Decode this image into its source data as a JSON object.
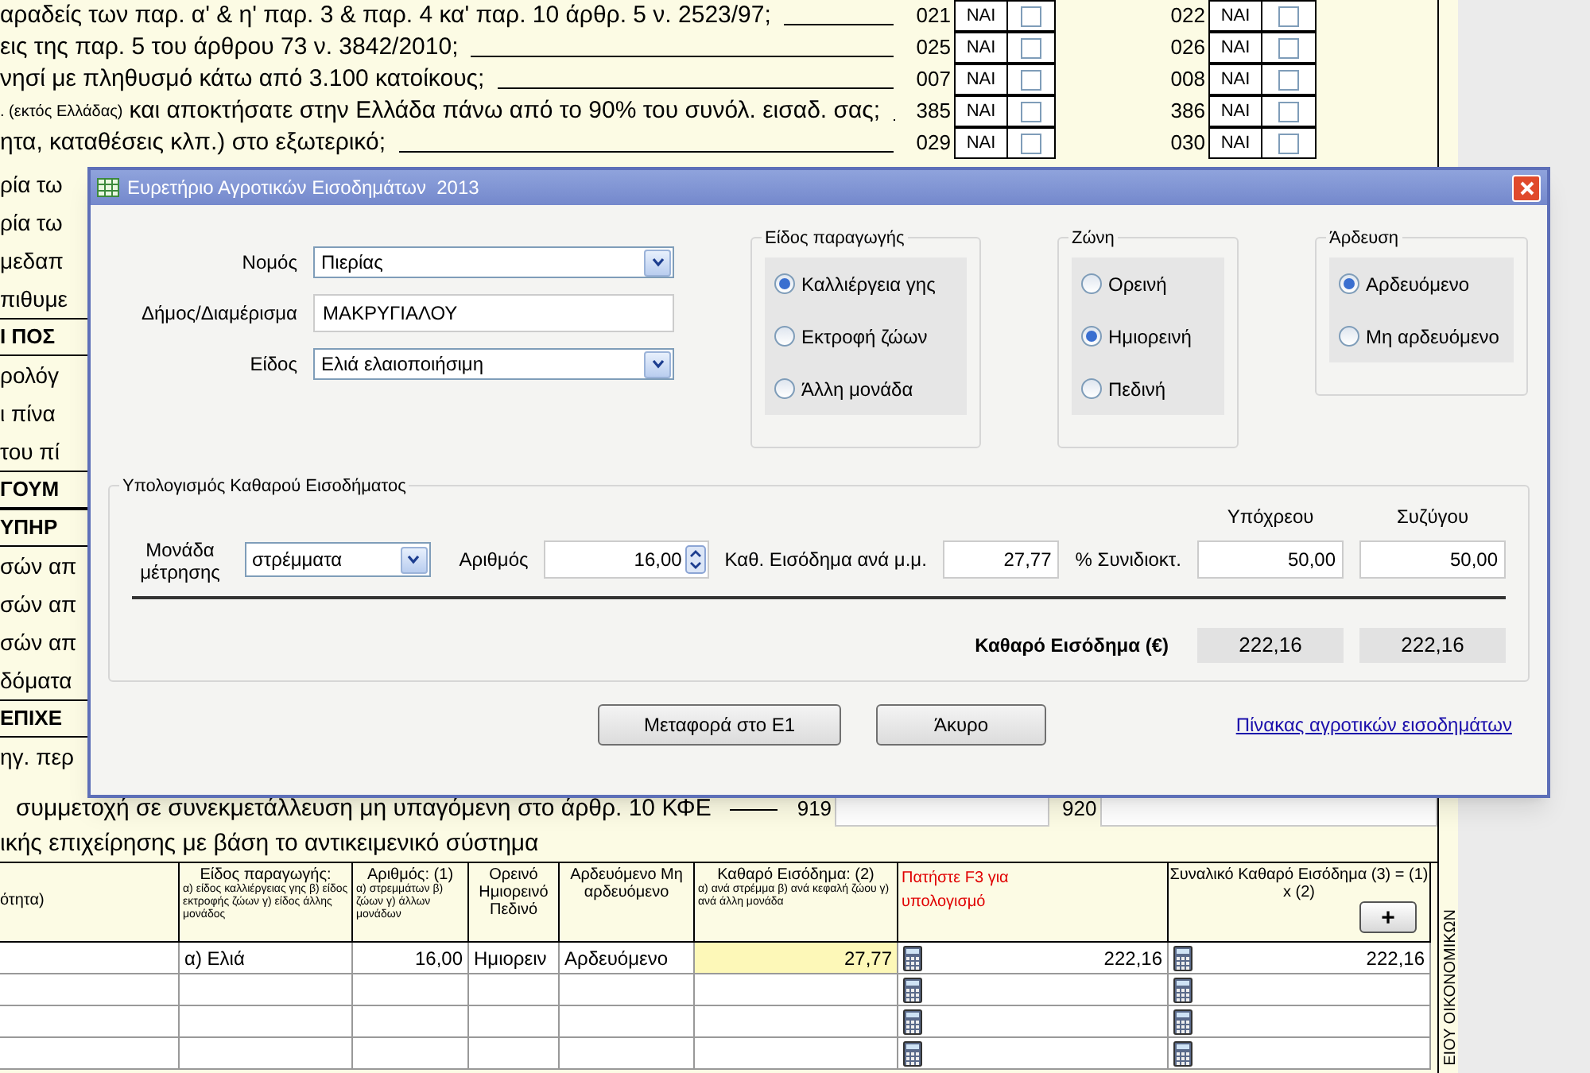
{
  "background_form": {
    "question_rows": [
      {
        "prefix": "",
        "text": "αραδείς των παρ. α' & η' παρ. 3 & παρ. 4 κα' παρ. 10 άρθρ. 5 ν. 2523/97;",
        "code_1": "021",
        "answer_1": "ΝΑΙ",
        "checked_1": false,
        "code_2": "022",
        "answer_2": "ΝΑΙ",
        "checked_2": false
      },
      {
        "prefix": "",
        "text": "εις της παρ. 5 του άρθρου 73 ν. 3842/2010;",
        "code_1": "025",
        "answer_1": "ΝΑΙ",
        "checked_1": false,
        "code_2": "026",
        "answer_2": "ΝΑΙ",
        "checked_2": false
      },
      {
        "prefix": "",
        "text": "νησί με πληθυσμό κάτω από 3.100 κατοίκους;",
        "code_1": "007",
        "answer_1": "ΝΑΙ",
        "checked_1": false,
        "code_2": "008",
        "answer_2": "ΝΑΙ",
        "checked_2": false
      },
      {
        "prefix": ". (εκτός Ελλάδας)",
        "text": "και αποκτήσατε στην Ελλάδα πάνω από το 90% του συνόλ. εισαδ. σας;",
        "code_1": "385",
        "answer_1": "ΝΑΙ",
        "checked_1": false,
        "code_2": "386",
        "answer_2": "ΝΑΙ",
        "checked_2": false
      },
      {
        "prefix": "",
        "text": "ητα, καταθέσεις κλπ.) στο εξωτερικό;",
        "code_1": "029",
        "answer_1": "ΝΑΙ",
        "checked_1": false,
        "code_2": "030",
        "answer_2": "ΝΑΙ",
        "checked_2": false
      }
    ],
    "left_fragments": [
      {
        "text": "ρία τω",
        "bold": false
      },
      {
        "text": "ρία τω",
        "bold": false
      },
      {
        "text": "μεδαπ",
        "bold": false
      },
      {
        "text": "πιθυμε",
        "bold": false
      },
      {
        "text": "Ι ΠΟΣ",
        "bold": true
      },
      {
        "text": "ρολόγ",
        "bold": false
      },
      {
        "text": "ι πίνα",
        "bold": false
      },
      {
        "text": "του πί",
        "bold": false
      },
      {
        "text": "ΓΟΥΜ",
        "bold": true
      },
      {
        "text": "ΥΠΗΡ",
        "bold": true
      },
      {
        "text": "σών απ",
        "bold": false
      },
      {
        "text": "σών απ",
        "bold": false
      },
      {
        "text": "σών απ",
        "bold": false
      },
      {
        "text": "δόματα",
        "bold": false
      },
      {
        "text": "ΕΠΙΧΕ",
        "bold": true
      },
      {
        "text": "ηγ. περ",
        "bold": false
      }
    ],
    "row_919": {
      "text": "συμμετοχή σε συνεκμετάλλευση μη υπαγόμενη στο άρθρ. 10 ΚΦΕ",
      "code_1": "919",
      "code_2": "920"
    },
    "subtitle": "ικής επιχείρησης με βάση το αντικειμενικό σύστημα",
    "side_label": "ΕΙΟΥ ΟΙΚΟΝΟΜΙΚΩΝ",
    "table": {
      "columns": [
        {
          "title": "ότητα)"
        },
        {
          "title": "Είδος παραγωγής:",
          "note": "α) είδος καλλιέργειας γης β) είδος εκτροφής ζώων γ) είδος άλλης μονάδος"
        },
        {
          "title": "Αριθμός: (1)",
          "note": "α) στρεμμάτων β) ζώων γ) άλλων μονάδων"
        },
        {
          "title": "Ορεινό Ημιορεινό Πεδινό"
        },
        {
          "title": "Αρδευόμενο Μη αρδευόμενο"
        },
        {
          "title": "Καθαρό Εισόδημα: (2)",
          "note": "α) ανά στρέμμα β) ανά κεφαλή ζώου γ) ανά άλλη μονάδα"
        },
        {
          "title": "Πατήστε F3 για υπολογισμό"
        },
        {
          "title": "Συναλικό Καθαρό Εισόδημα (3) = (1) x (2)"
        }
      ],
      "add_button": "+",
      "rows": [
        {
          "cells": [
            "",
            "α) Ελιά",
            "16,00",
            "Ημιορειν",
            "Αρδευόμενο",
            "27,77",
            "222,16",
            "222,16"
          ]
        },
        {
          "cells": [
            "",
            "",
            "",
            "",
            "",
            "",
            "",
            ""
          ]
        },
        {
          "cells": [
            "",
            "",
            "",
            "",
            "",
            "",
            "",
            ""
          ]
        },
        {
          "cells": [
            "",
            "",
            "",
            "",
            "",
            "",
            "",
            ""
          ]
        }
      ]
    }
  },
  "dialog": {
    "title": "Ευρετήριο Αγροτικών Εισοδημάτων  2013",
    "fields": [
      {
        "kind": "select",
        "label": "Νομός",
        "value": "Πιερίας"
      },
      {
        "kind": "text",
        "label": "Δήμος/Διαμέρισμα",
        "value": "ΜΑΚΡΥΓΙΑΛΟΥ"
      },
      {
        "kind": "select",
        "label": "Είδος",
        "value": "Ελιά ελαιοποιήσιμη"
      }
    ],
    "radio_groups": [
      {
        "title": "Είδος παραγωγής",
        "options": [
          {
            "label": "Καλλιέργεια γης",
            "selected": true
          },
          {
            "label": "Εκτροφή ζώων",
            "selected": false
          },
          {
            "label": "Άλλη μονάδα",
            "selected": false
          }
        ]
      },
      {
        "title": "Ζώνη",
        "options": [
          {
            "label": "Ορεινή",
            "selected": false
          },
          {
            "label": "Ημιορεινή",
            "selected": true
          },
          {
            "label": "Πεδινή",
            "selected": false
          }
        ]
      },
      {
        "title": "Άρδευση",
        "options": [
          {
            "label": "Αρδευόμενο",
            "selected": true
          },
          {
            "label": "Μη αρδευόμενο",
            "selected": false
          }
        ]
      }
    ],
    "calculation": {
      "title": "Υπολογισμός Καθαρού Εισοδήματος",
      "unit_label": "Μονάδα μέτρησης",
      "unit_value": "στρέμματα",
      "count_label": "Αριθμός",
      "count_value": "16,00",
      "rate_label": "Καθ. Εισόδημα ανά μ.μ.",
      "rate_value": "27,77",
      "share_label": "% Συνιδιοκτ.",
      "share_columns": [
        {
          "heading": "Υπόχρεου",
          "value": "50,00"
        },
        {
          "heading": "Συζύγου",
          "value": "50,00"
        }
      ],
      "net_label": "Καθαρό Εισόδημα (€)",
      "net_values": [
        "222,16",
        "222,16"
      ]
    },
    "buttons": [
      "Μεταφορά στο Ε1",
      "Άκυρο"
    ],
    "link": "Πίνακας αγροτικών εισοδημάτων"
  }
}
